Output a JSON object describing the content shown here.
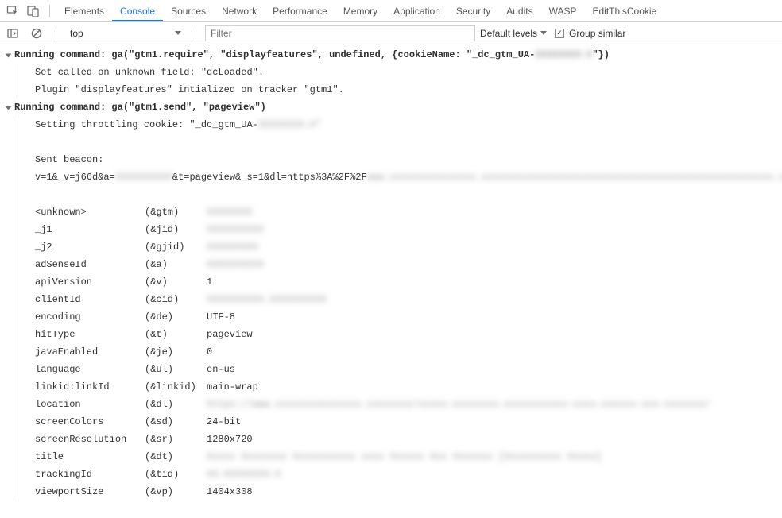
{
  "tabs": [
    "Elements",
    "Console",
    "Sources",
    "Network",
    "Performance",
    "Memory",
    "Application",
    "Security",
    "Audits",
    "WASP",
    "EditThisCookie"
  ],
  "activeTab": "Console",
  "context": "top",
  "filterPlaceholder": "Filter",
  "levels": "Default levels",
  "groupSimilar": "Group similar",
  "line1": "Running command: ga(\"gtm1.require\", \"displayfeatures\", undefined, {cookieName: \"_dc_gtm_UA-",
  "line1b": "\"})",
  "line1blur": "XXXXXXXX-X",
  "line2": "Set called on unknown field: \"dcLoaded\".",
  "line3": "Plugin \"displayfeatures\" intialized on tracker \"gtm1\".",
  "line4": "Running command: ga(\"gtm1.send\", \"pageview\")",
  "line5": "Setting throttling cookie: \"_dc_gtm_UA-",
  "line5blur": "XXXXXXXX-X\"",
  "line6": "Sent beacon:",
  "line7a": "v=1&_v=j66d&a=",
  "line7blur": "XXXXXXXXXX",
  "line7b": "&t=pageview&_s=1&dl=https%3A%2F%2F",
  "line7blur2": "www.xxxxxxxxxxxxxxx.xxxxxxxxxxxxxxxxxxxxxxxxxxxxxxxxxxxxxxxxxxxxxxxxxxx.x",
  "params": [
    {
      "k": "<unknown>",
      "p": "(&gtm)",
      "v": "XXXXXXXX",
      "blur": true
    },
    {
      "k": "_j1",
      "p": "(&jid)",
      "v": "XXXXXXXXXX",
      "blur": true
    },
    {
      "k": "_j2",
      "p": "(&gjid)",
      "v": "XXXXXXXXX",
      "blur": true
    },
    {
      "k": "adSenseId",
      "p": "(&a)",
      "v": "XXXXXXXXXX",
      "blur": true
    },
    {
      "k": "apiVersion",
      "p": "(&v)",
      "v": "1",
      "blur": false
    },
    {
      "k": "clientId",
      "p": "(&cid)",
      "v": "XXXXXXXXXX.XXXXXXXXXX",
      "blur": true
    },
    {
      "k": "encoding",
      "p": "(&de)",
      "v": "UTF-8",
      "blur": false
    },
    {
      "k": "hitType",
      "p": "(&t)",
      "v": "pageview",
      "blur": false
    },
    {
      "k": "javaEnabled",
      "p": "(&je)",
      "v": "0",
      "blur": false
    },
    {
      "k": "language",
      "p": "(&ul)",
      "v": "en-us",
      "blur": false
    },
    {
      "k": "linkid:linkId",
      "p": "(&linkid)",
      "v": "main-wrap",
      "blur": false
    },
    {
      "k": "location",
      "p": "(&dl)",
      "v": "https://www.xxxxxxxxxxxxxxx.xxxxxxxx/xxxxx-xxxxxxxx-xxxxxxxxxxx-xxxx-xxxxxx-xxx-xxxxxxx/",
      "blur": true
    },
    {
      "k": "screenColors",
      "p": "(&sd)",
      "v": "24-bit",
      "blur": false
    },
    {
      "k": "screenResolution",
      "p": "(&sr)",
      "v": "1280x720",
      "blur": false
    },
    {
      "k": "title",
      "p": "(&dt)",
      "v": "Xxxxx Xxxxxxxx Xxxxxxxxxxx xxxx Xxxxxx Xxx Xxxxxxx [Xxxxxxxxxx Xxxxx]",
      "blur": true
    },
    {
      "k": "trackingId",
      "p": "(&tid)",
      "v": "XX-XXXXXXXX-X",
      "blur": true
    },
    {
      "k": "viewportSize",
      "p": "(&vp)",
      "v": "1404x308",
      "blur": false
    }
  ]
}
